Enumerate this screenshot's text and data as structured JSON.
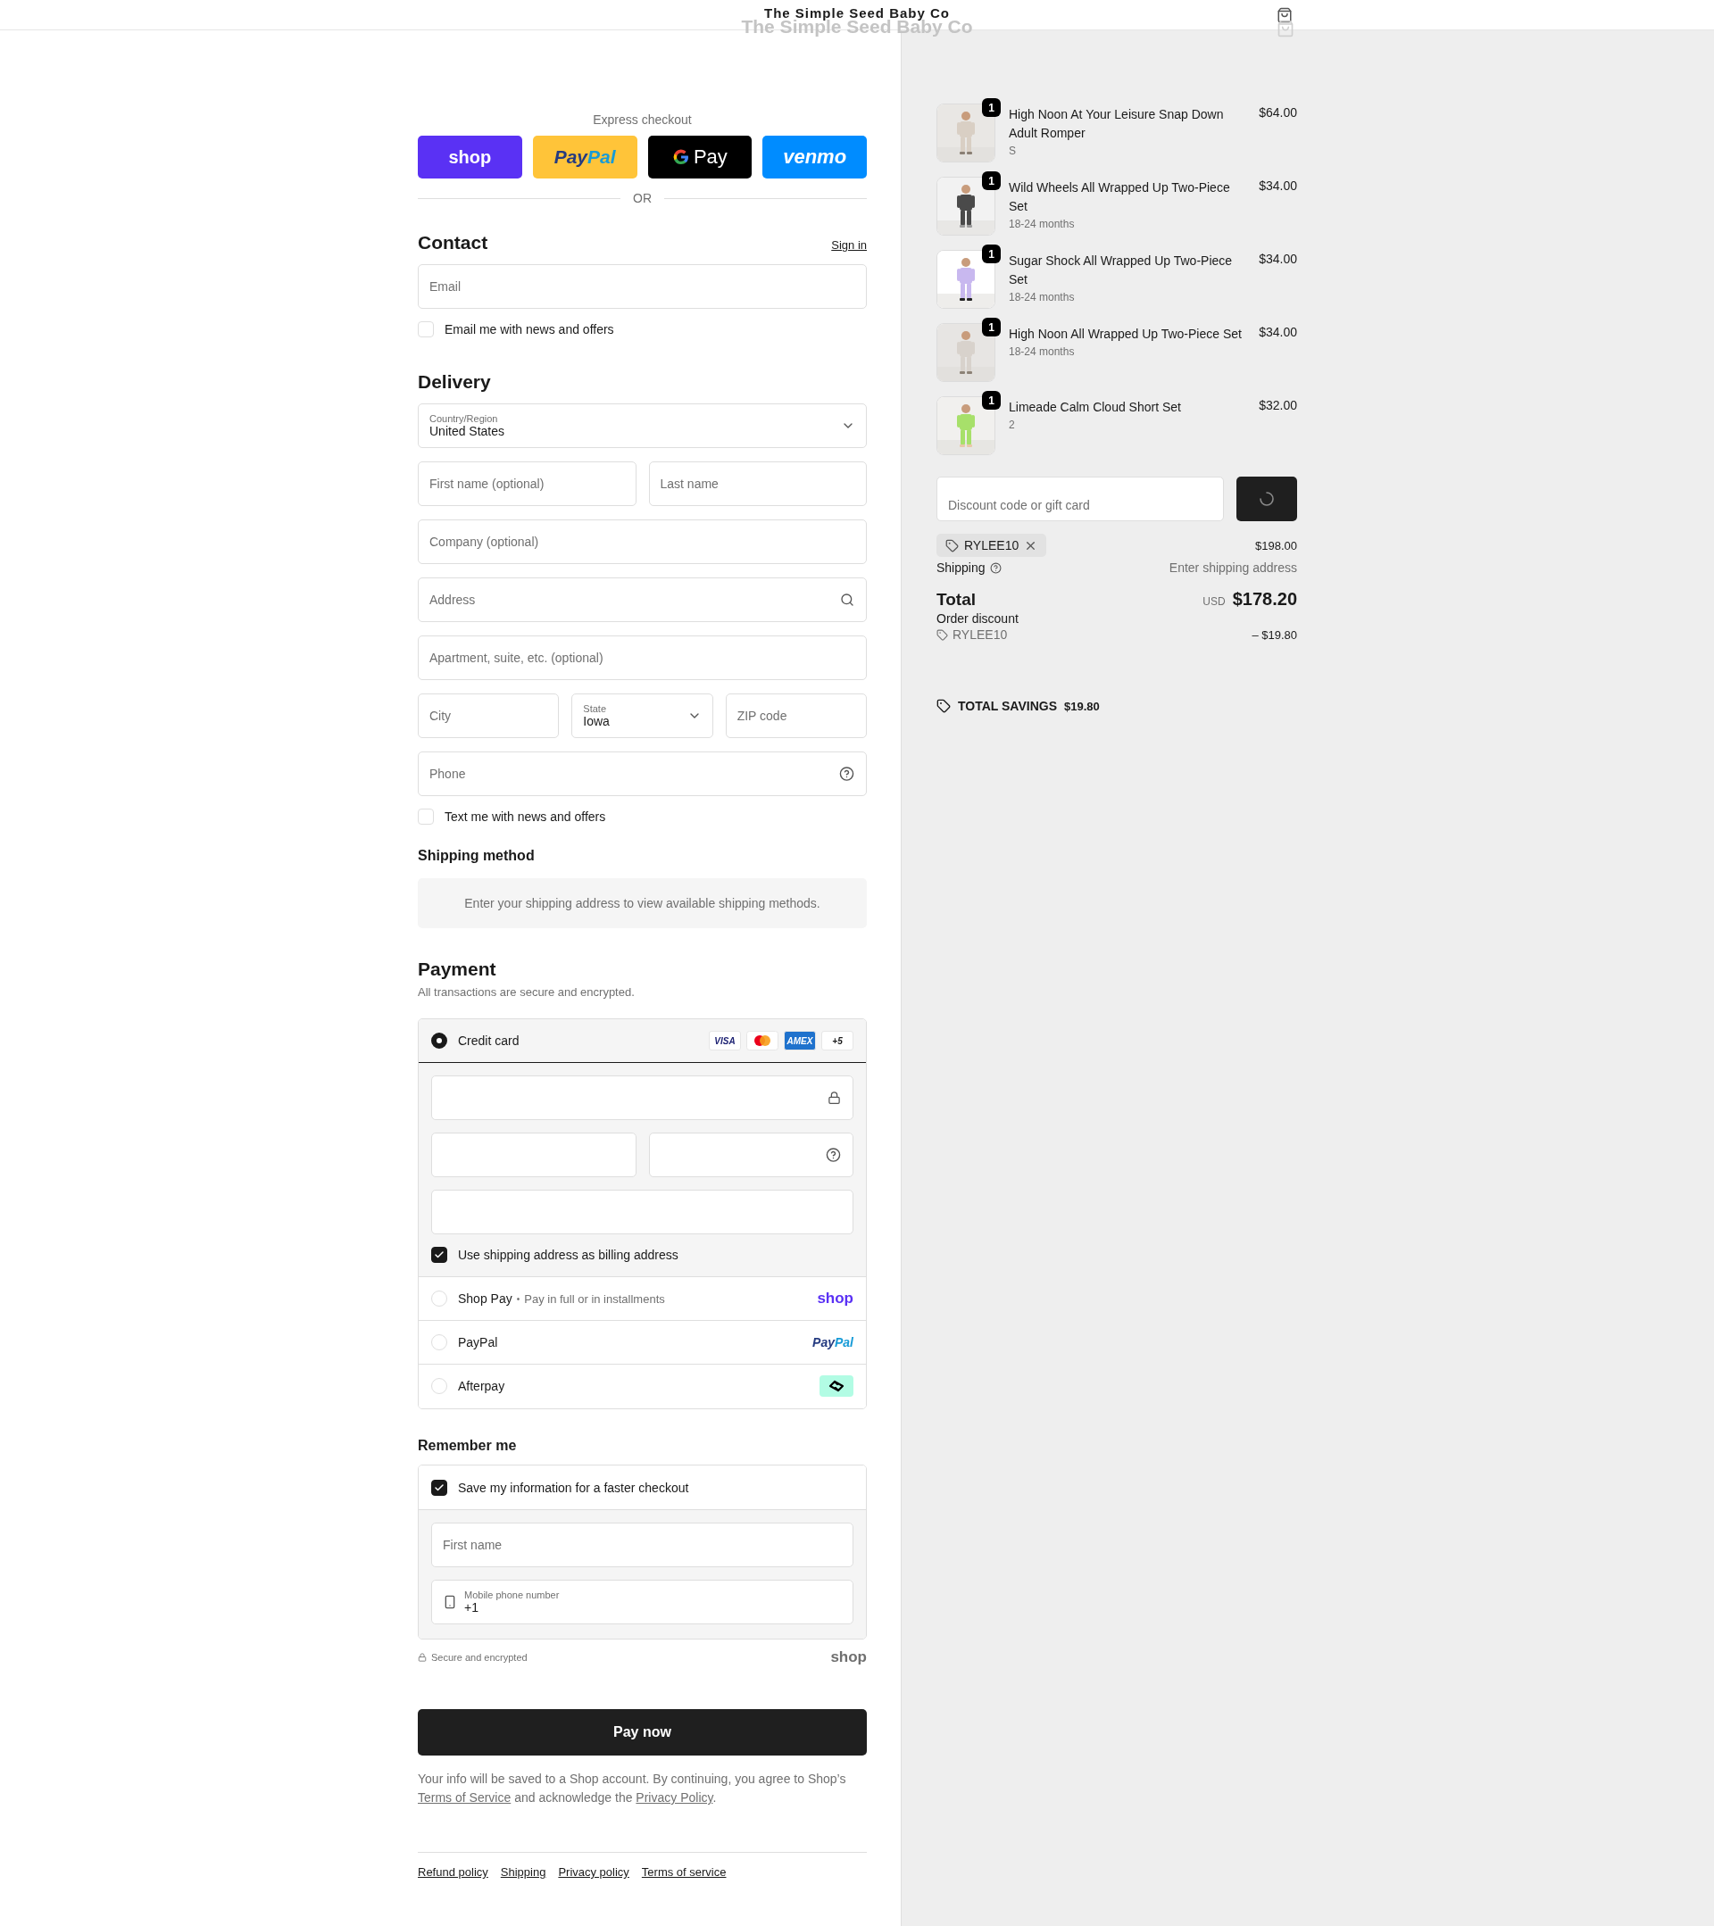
{
  "header": {
    "store_name": "The Simple Seed Baby Co",
    "ghost_store_name": "The Simple Seed Baby Co"
  },
  "express_checkout": {
    "label": "Express checkout",
    "divider": "OR",
    "buttons": [
      {
        "kind": "shop",
        "parts": [
          "shop"
        ]
      },
      {
        "kind": "paypal",
        "parts": [
          "Pay",
          "Pal"
        ]
      },
      {
        "kind": "gpay",
        "parts": [
          "Pay"
        ]
      },
      {
        "kind": "venmo",
        "parts": [
          "venmo"
        ]
      }
    ]
  },
  "contact": {
    "title": "Contact",
    "sign_in": "Sign in",
    "email": {
      "placeholder": "Email"
    },
    "news_checkbox": {
      "label": "Email me with news and offers",
      "checked": false
    }
  },
  "delivery": {
    "title": "Delivery",
    "rows": [
      [
        {
          "kind": "select",
          "label": "Country/Region",
          "value": "United States"
        }
      ],
      [
        {
          "kind": "text",
          "placeholder": "First name (optional)"
        },
        {
          "kind": "text",
          "placeholder": "Last name"
        }
      ],
      [
        {
          "kind": "text",
          "placeholder": "Company (optional)"
        }
      ],
      [
        {
          "kind": "search",
          "placeholder": "Address"
        }
      ],
      [
        {
          "kind": "text",
          "placeholder": "Apartment, suite, etc. (optional)"
        }
      ],
      [
        {
          "kind": "text",
          "placeholder": "City"
        },
        {
          "kind": "select",
          "label": "State",
          "value": "Iowa"
        },
        {
          "kind": "text",
          "placeholder": "ZIP code"
        }
      ],
      [
        {
          "kind": "help",
          "placeholder": "Phone"
        }
      ]
    ],
    "sms_checkbox": {
      "label": "Text me with news and offers",
      "checked": false
    }
  },
  "shipping_method": {
    "title": "Shipping method",
    "message": "Enter your shipping address to view available shipping methods."
  },
  "payment": {
    "title": "Payment",
    "subtitle": "All transactions are secure and encrypted.",
    "methods": [
      {
        "kind": "card",
        "label": "Credit card",
        "selected": true,
        "brands": [
          {
            "kind": "visa",
            "label": "VISA"
          },
          {
            "kind": "mastercard"
          },
          {
            "kind": "amex",
            "label": "AMEX"
          },
          {
            "kind": "more",
            "label": "+5"
          }
        ],
        "field_rows": [
          [
            {
              "kind": "lock"
            }
          ],
          [
            {
              "kind": "text"
            },
            {
              "kind": "help"
            }
          ],
          [
            {
              "kind": "text"
            }
          ]
        ],
        "billing_checkbox": {
          "label": "Use shipping address as billing address",
          "checked": true
        }
      },
      {
        "kind": "shoppay",
        "label": "Shop Pay",
        "separator": "•",
        "note": "Pay in full or in installments",
        "selected": false,
        "logo": [
          "shop"
        ]
      },
      {
        "kind": "paypal",
        "label": "PayPal",
        "selected": false,
        "logo": [
          "Pay",
          "Pal"
        ]
      },
      {
        "kind": "afterpay",
        "label": "Afterpay",
        "selected": false
      }
    ]
  },
  "remember_me": {
    "title": "Remember me",
    "save_checkbox": {
      "label": "Save my information for a faster checkout",
      "checked": true
    },
    "first_name": {
      "placeholder": "First name"
    },
    "phone": {
      "label": "Mobile phone number",
      "value": "+1"
    },
    "secure_note": "Secure and encrypted",
    "shop_logo": "shop"
  },
  "pay_button": "Pay now",
  "legal": {
    "before": "Your info will be saved to a Shop account. By continuing, you agree to Shop’s",
    "terms": "Terms of Service",
    "middle": "and acknowledge the",
    "privacy": "Privacy Policy",
    "end": "."
  },
  "footer_links": [
    "Refund policy",
    "Shipping",
    "Privacy policy",
    "Terms of service"
  ],
  "summary": {
    "items": [
      {
        "name": "High Noon At Your Leisure Snap Down Adult Romper",
        "variant": "S",
        "price": "$64.00",
        "quantity": "1"
      },
      {
        "name": "Wild Wheels All Wrapped Up Two-Piece Set",
        "variant": "18-24 months",
        "price": "$34.00",
        "quantity": "1"
      },
      {
        "name": "Sugar Shock All Wrapped Up Two-Piece Set",
        "variant": "18-24 months",
        "price": "$34.00",
        "quantity": "1"
      },
      {
        "name": "High Noon All Wrapped Up Two-Piece Set",
        "variant": "18-24 months",
        "price": "$34.00",
        "quantity": "1"
      },
      {
        "name": "Limeade Calm Cloud Short Set",
        "variant": "2",
        "price": "$32.00",
        "quantity": "1"
      }
    ],
    "discount": {
      "placeholder": "Discount code or gift card"
    },
    "applied_code": "RYLEE10",
    "subtotal": "$198.00",
    "shipping": {
      "label": "Shipping",
      "value": "Enter shipping address"
    },
    "total": {
      "label": "Total",
      "currency": "USD",
      "amount": "$178.20"
    },
    "order_discount": {
      "label": "Order discount",
      "code": "RYLEE10",
      "amount": "– $19.80"
    },
    "savings": {
      "label": "TOTAL SAVINGS",
      "amount": "$19.80"
    }
  }
}
